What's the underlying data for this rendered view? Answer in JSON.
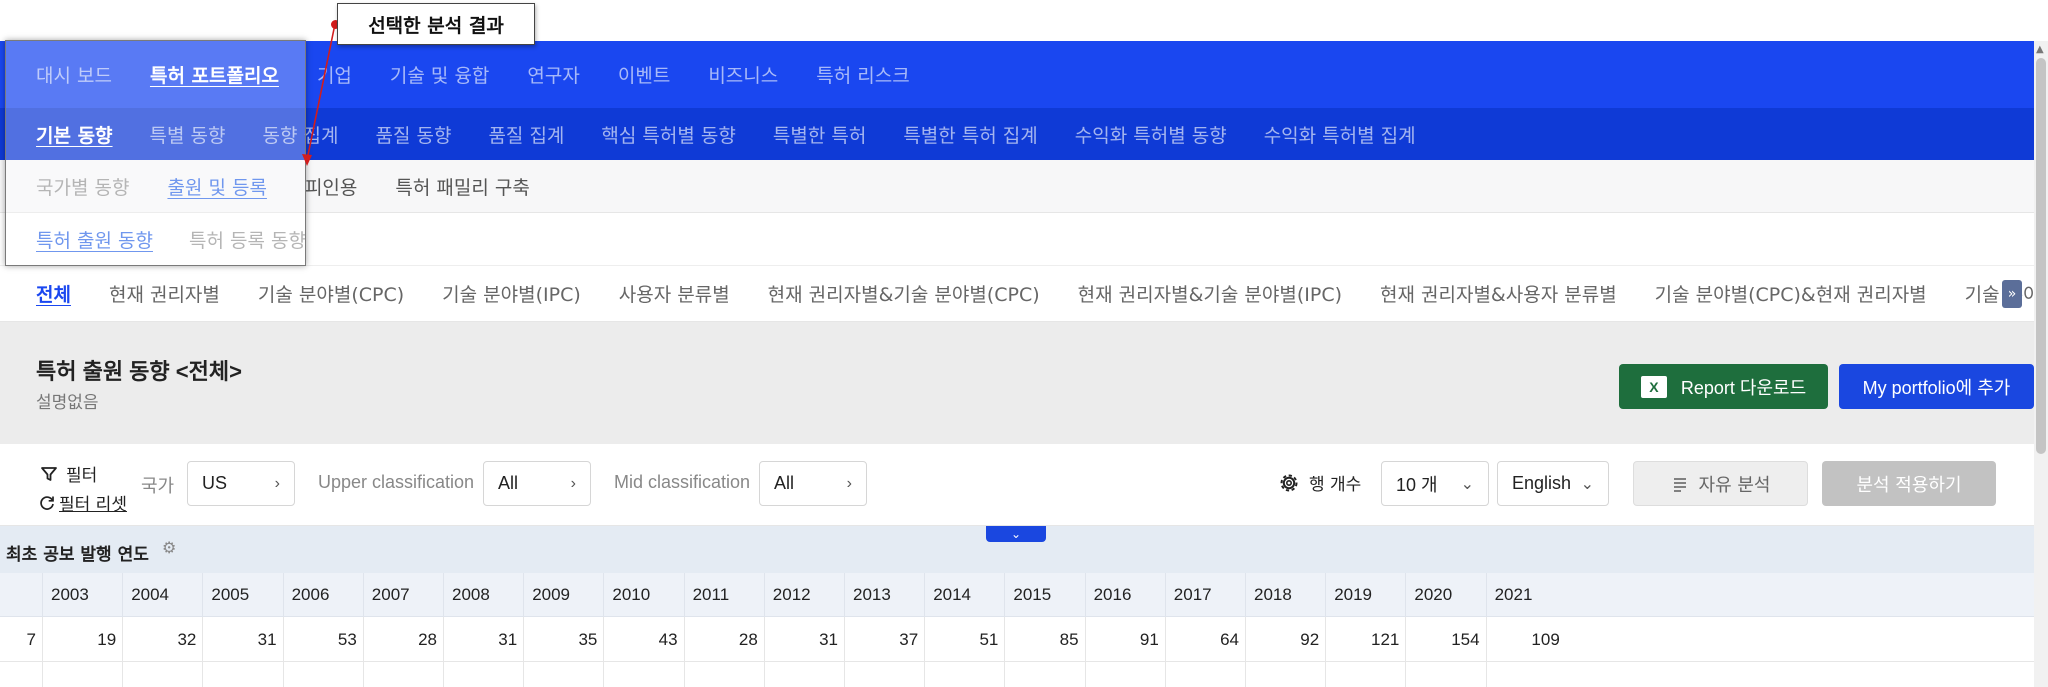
{
  "nav1": {
    "items": [
      "대시 보드",
      "특허 포트폴리오",
      "기업",
      "기술 및 융합",
      "연구자",
      "이벤트",
      "비즈니스",
      "특허 리스크"
    ],
    "active": 1
  },
  "nav2": {
    "items": [
      "기본 동향",
      "특별 동향",
      "동향 집계",
      "품질 동향",
      "품질 집계",
      "핵심 특허별 동향",
      "특별한 특허",
      "특별한 특허 집계",
      "수익화 특허별 동향",
      "수익화 특허별 집계"
    ],
    "active": 0
  },
  "nav3": {
    "items": [
      "국가별 동향",
      "출원 및 등록",
      "피인용",
      "특허 패밀리 구축"
    ],
    "active": 1
  },
  "nav4": {
    "items": [
      "특허 출원 동향",
      "특허 등록 동향"
    ],
    "active": 0
  },
  "tabs": {
    "items": [
      "전체",
      "현재 권리자별",
      "기술 분야별(CPC)",
      "기술 분야별(IPC)",
      "사용자 분류별",
      "현재 권리자별&기술 분야별(CPC)",
      "현재 권리자별&기술 분야별(IPC)",
      "현재 권리자별&사용자 분류별",
      "기술 분야별(CPC)&현재 권리자별",
      "기술 분야별(IPC)&현재 권리자별"
    ],
    "active": 0,
    "scroll_icon": "double-chevron-right-icon"
  },
  "header": {
    "title": "특허 출원 동향 <전체>",
    "description": "설명없음",
    "report_button": "Report 다운로드",
    "report_icon": "excel-icon",
    "portfolio_button": "My portfolio에 추가"
  },
  "filters": {
    "filter_label": "필터",
    "filter_reset": "필터 리셋",
    "country_label": "국가",
    "country_value": "US",
    "upper_label": "Upper classification",
    "upper_value": "All",
    "mid_label": "Mid classification",
    "mid_value": "All",
    "rowcount_label": "행 개수",
    "rowcount_value": "10 개",
    "language_value": "English",
    "free_analysis_button": "자유 분석",
    "apply_button": "분석 적용하기"
  },
  "table": {
    "title": "최초 공보 발행 연도",
    "years": [
      "2003",
      "2004",
      "2005",
      "2006",
      "2007",
      "2008",
      "2009",
      "2010",
      "2011",
      "2012",
      "2013",
      "2014",
      "2015",
      "2016",
      "2017",
      "2018",
      "2019",
      "2020",
      "2021"
    ],
    "first_value": "7",
    "values": [
      "19",
      "32",
      "31",
      "53",
      "28",
      "31",
      "35",
      "43",
      "28",
      "31",
      "37",
      "51",
      "85",
      "91",
      "64",
      "92",
      "121",
      "154",
      "109"
    ]
  },
  "annotation": {
    "label": "선택한 분석 결과",
    "color": "#d21d1d"
  },
  "colors": {
    "nav1_bg": "#1a47f0",
    "nav2_bg": "#0f3ad6",
    "report_green": "#1e6e3d",
    "portfolio_blue": "#1a47e0"
  }
}
